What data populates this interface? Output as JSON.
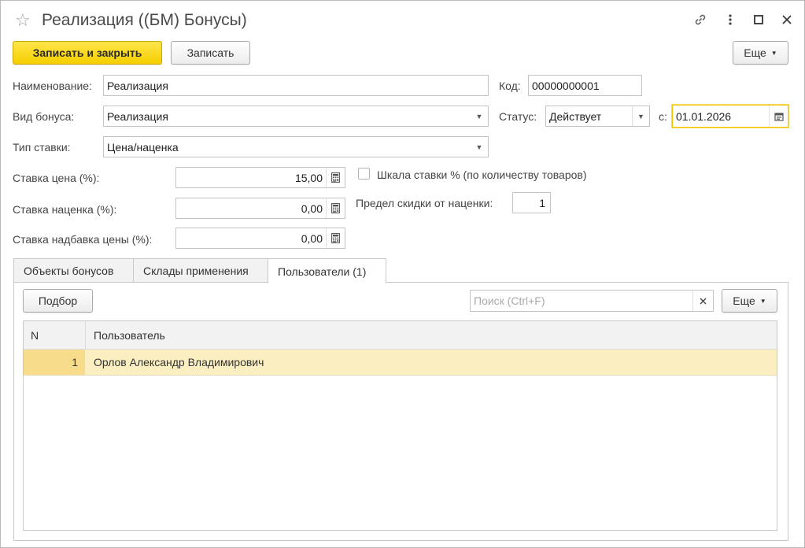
{
  "window": {
    "title": "Реализация ((БМ) Бонусы)"
  },
  "toolbar": {
    "save_close_label": "Записать и закрыть",
    "save_label": "Записать",
    "more_label": "Еще"
  },
  "form": {
    "name_label": "Наименование:",
    "name_value": "Реализация",
    "code_label": "Код:",
    "code_value": "00000000001",
    "bonus_type_label": "Вид бонуса:",
    "bonus_type_value": "Реализация",
    "status_label": "Статус:",
    "status_value": "Действует",
    "date_from_label": "с:",
    "date_from_value": "01.01.2026",
    "rate_type_label": "Тип ставки:",
    "rate_type_value": "Цена/наценка",
    "rate_price_label": "Ставка цена (%):",
    "rate_price_value": "15,00",
    "rate_markup_label": "Ставка наценка (%):",
    "rate_markup_value": "0,00",
    "rate_surcharge_label": "Ставка надбавка цены (%):",
    "rate_surcharge_value": "0,00",
    "scale_checkbox_label": "Шкала ставки % (по количеству товаров)",
    "scale_checked": false,
    "discount_limit_label": "Предел скидки от наценки:",
    "discount_limit_value": "1"
  },
  "tabs": [
    {
      "label": "Объекты бонусов",
      "active": false
    },
    {
      "label": "Склады применения",
      "active": false
    },
    {
      "label": "Пользователи (1)",
      "active": true
    }
  ],
  "users_tab": {
    "select_button_label": "Подбор",
    "search_placeholder": "Поиск (Ctrl+F)",
    "more_label": "Еще",
    "columns": {
      "n": "N",
      "user": "Пользователь"
    },
    "rows": [
      {
        "n": "1",
        "user": "Орлов Александр Владимирович"
      }
    ]
  },
  "colors": {
    "primary_button": "#f5cf00",
    "selected_row": "#fbeec0",
    "focused_border": "#f0c400"
  },
  "icons": [
    "star-icon",
    "link-icon",
    "more-vertical-icon",
    "maximize-icon",
    "close-icon",
    "calculator-icon",
    "calendar-icon",
    "dropdown-arrow-icon"
  ]
}
